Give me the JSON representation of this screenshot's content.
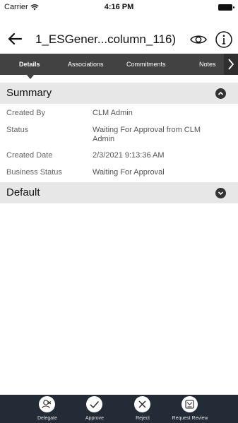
{
  "status_bar": {
    "carrier": "Carrier",
    "time": "4:16 PM"
  },
  "nav": {
    "title": "1_ESGener...column_116)"
  },
  "tabs": [
    {
      "label": "Details"
    },
    {
      "label": "Associations"
    },
    {
      "label": "Commitments"
    },
    {
      "label": "Notes"
    }
  ],
  "sections": {
    "summary": {
      "title": "Summary"
    },
    "default": {
      "title": "Default"
    }
  },
  "summary_rows": [
    {
      "key": "Created By",
      "value": "CLM Admin"
    },
    {
      "key": "Status",
      "value": "Waiting For Approval from CLM Admin"
    },
    {
      "key": "Created Date",
      "value": "2/3/2021 9:13:36 AM"
    },
    {
      "key": "Business Status",
      "value": "Waiting For Approval"
    }
  ],
  "actions": [
    {
      "label": "Delegate",
      "icon": "delegate-icon"
    },
    {
      "label": "Approve",
      "icon": "checkmark-icon"
    },
    {
      "label": "Reject",
      "icon": "close-icon"
    },
    {
      "label": "Request Review",
      "icon": "request-review-icon"
    }
  ],
  "colors": {
    "tab_bar": "#424242",
    "section_bg": "#e7e7e7",
    "bottom_bar": "#222b36"
  }
}
